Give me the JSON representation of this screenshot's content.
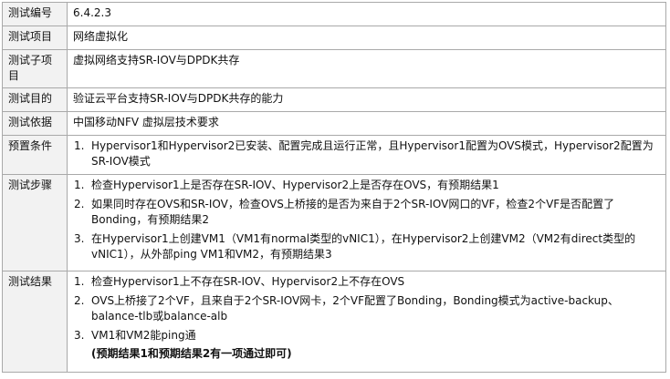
{
  "rows": {
    "test_id": {
      "label": "测试编号",
      "value": "6.4.2.3"
    },
    "test_item": {
      "label": "测试项目",
      "value": "网络虚拟化"
    },
    "test_subitem": {
      "label": "测试子项目",
      "value": "虚拟网络支持SR-IOV与DPDK共存"
    },
    "test_purpose": {
      "label": "测试目的",
      "value": "验证云平台支持SR-IOV与DPDK共存的能力"
    },
    "test_basis": {
      "label": "测试依据",
      "value": "中国移动NFV 虚拟层技术要求"
    },
    "preconditions": {
      "label": "预置条件",
      "items": [
        {
          "num": "1.",
          "text": "Hypervisor1和Hypervisor2已安装、配置完成且运行正常，且Hypervisor1配置为OVS模式，Hypervisor2配置为SR-IOV模式"
        }
      ]
    },
    "test_steps": {
      "label": "测试步骤",
      "items": [
        {
          "num": "1.",
          "text": "检查Hypervisor1上是否存在SR-IOV、Hypervisor2上是否存在OVS，有预期结果1"
        },
        {
          "num": "2.",
          "text": "如果同时存在OVS和SR-IOV，检查OVS上桥接的是否为来自于2个SR-IOV网口的VF，检查2个VF是否配置了Bonding，有预期结果2"
        },
        {
          "num": "3.",
          "text": "在Hypervisor1上创建VM1（VM1有normal类型的vNIC1），在Hypervisor2上创建VM2（VM2有direct类型的vNIC1），从外部ping VM1和VM2，有预期结果3"
        }
      ]
    },
    "test_results": {
      "label": "测试结果",
      "items": [
        {
          "num": "1.",
          "text": "检查Hypervisor1上不存在SR-IOV、Hypervisor2上不存在OVS"
        },
        {
          "num": "2.",
          "text": "OVS上桥接了2个VF，且来自于2个SR-IOV网卡，2个VF配置了Bonding，Bonding模式为active-backup、balance-tlb或balance-alb"
        },
        {
          "num": "3.",
          "text": "VM1和VM2能ping通"
        }
      ],
      "note": "(预期结果1和预期结果2有一项通过即可)"
    }
  }
}
